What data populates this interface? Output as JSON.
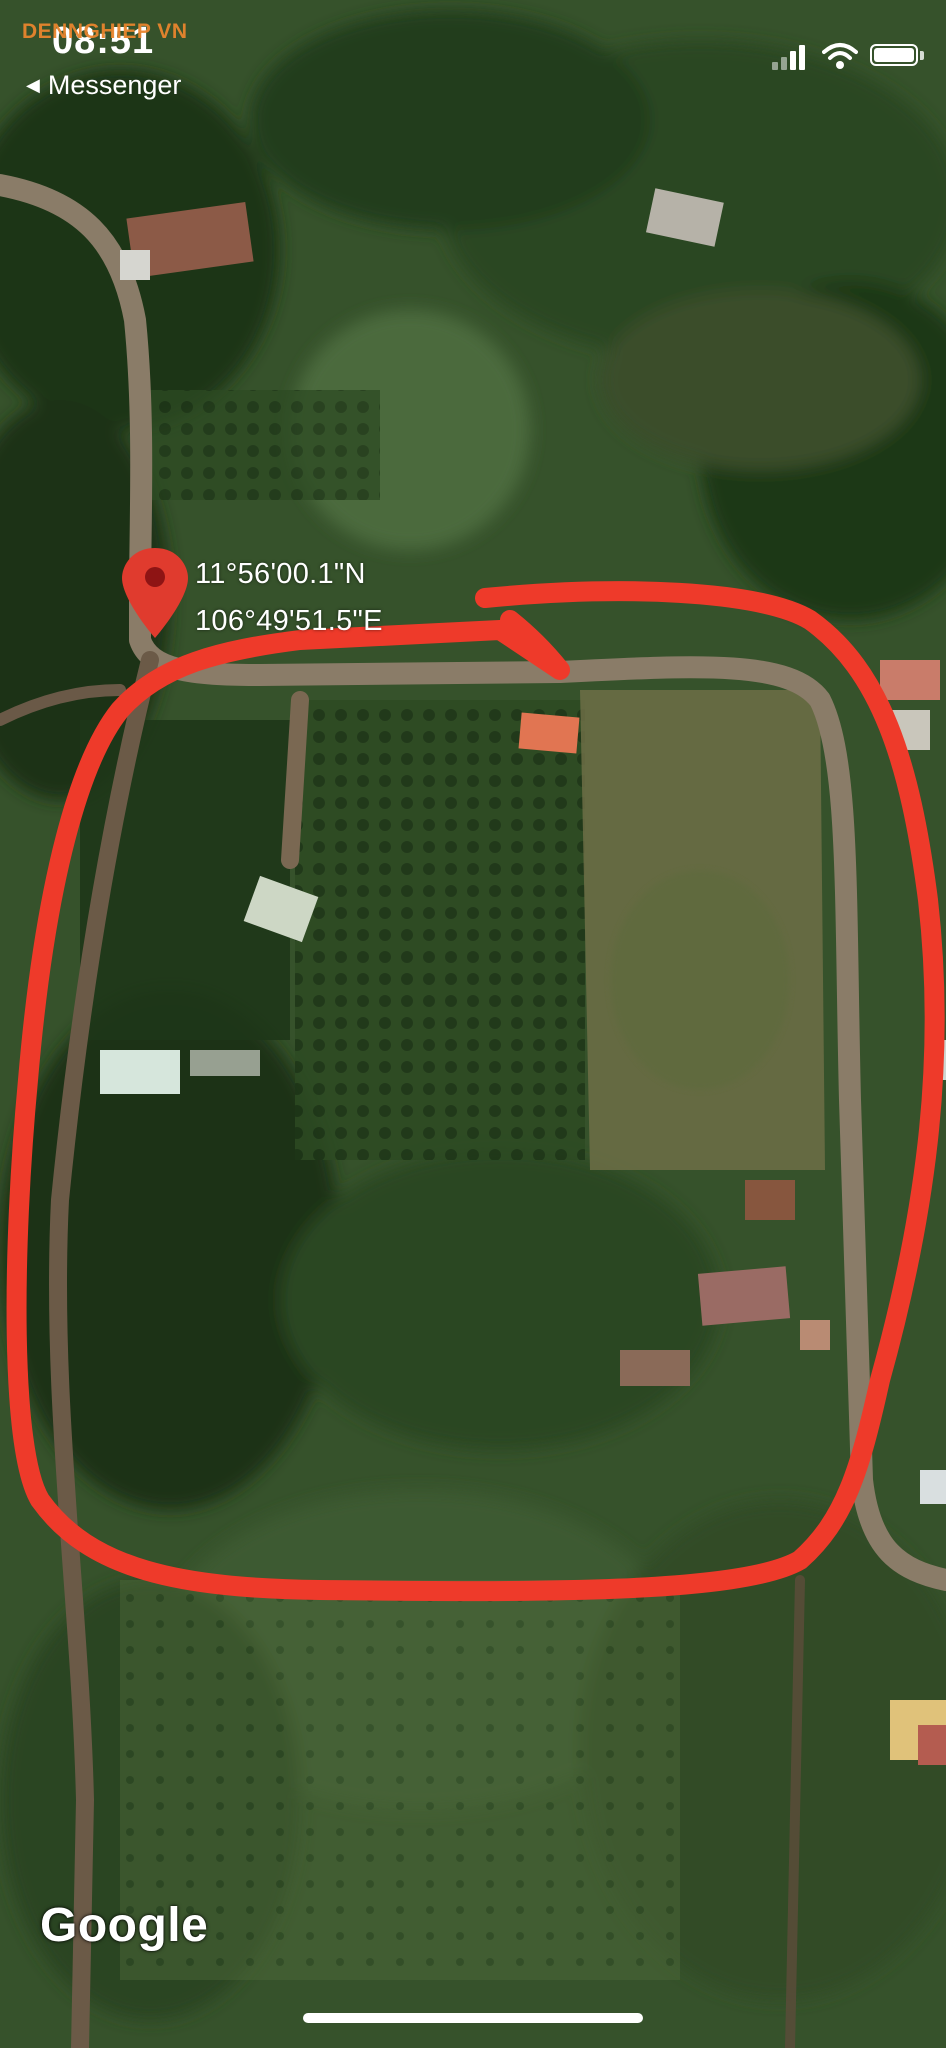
{
  "status_bar": {
    "time": "08:51",
    "back_label": "Messenger",
    "watermark": "DENNGHIEP VN"
  },
  "map": {
    "type": "satellite",
    "pin": {
      "latitude": "11°56'00.1\"N",
      "longitude": "106°49'51.5\"E",
      "color": "#e03b2e"
    },
    "annotation_color": "#ee3a2a",
    "attribution": "Google"
  }
}
